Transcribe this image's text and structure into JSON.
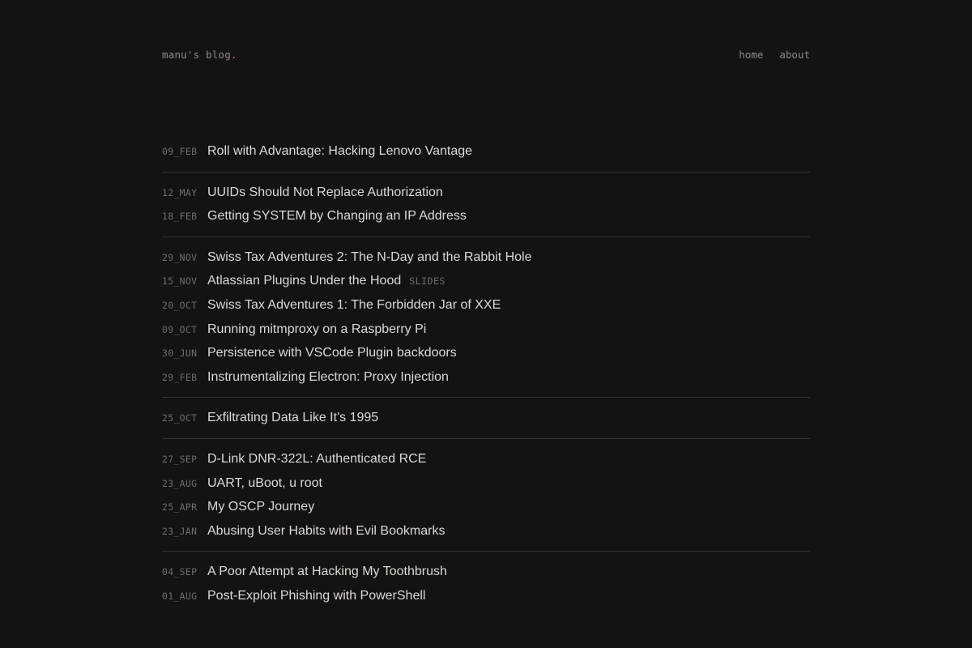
{
  "header": {
    "brand": "manu's blog",
    "brand_dot": ".",
    "nav": [
      {
        "label": "home"
      },
      {
        "label": "about"
      }
    ]
  },
  "groups": [
    {
      "posts": [
        {
          "date": "09_FEB",
          "title": "Roll with Advantage: Hacking Lenovo Vantage",
          "tag": ""
        }
      ]
    },
    {
      "posts": [
        {
          "date": "12_MAY",
          "title": "UUIDs Should Not Replace Authorization",
          "tag": ""
        },
        {
          "date": "18_FEB",
          "title": "Getting SYSTEM by Changing an IP Address",
          "tag": ""
        }
      ]
    },
    {
      "posts": [
        {
          "date": "29_NOV",
          "title": "Swiss Tax Adventures 2: The N-Day and the Rabbit Hole",
          "tag": ""
        },
        {
          "date": "15_NOV",
          "title": "Atlassian Plugins Under the Hood",
          "tag": "SLIDES"
        },
        {
          "date": "20_OCT",
          "title": "Swiss Tax Adventures 1: The Forbidden Jar of XXE",
          "tag": ""
        },
        {
          "date": "09_OCT",
          "title": "Running mitmproxy on a Raspberry Pi",
          "tag": ""
        },
        {
          "date": "30_JUN",
          "title": "Persistence with VSCode Plugin backdoors",
          "tag": ""
        },
        {
          "date": "29_FEB",
          "title": "Instrumentalizing Electron: Proxy Injection",
          "tag": ""
        }
      ]
    },
    {
      "posts": [
        {
          "date": "25_OCT",
          "title": "Exfiltrating Data Like It's 1995",
          "tag": ""
        }
      ]
    },
    {
      "posts": [
        {
          "date": "27_SEP",
          "title": "D-Link DNR-322L: Authenticated RCE",
          "tag": ""
        },
        {
          "date": "23_AUG",
          "title": "UART, uBoot, u root",
          "tag": ""
        },
        {
          "date": "25_APR",
          "title": "My OSCP Journey",
          "tag": ""
        },
        {
          "date": "23_JAN",
          "title": "Abusing User Habits with Evil Bookmarks",
          "tag": ""
        }
      ]
    },
    {
      "posts": [
        {
          "date": "04_SEP",
          "title": "A Poor Attempt at Hacking My Toothbrush",
          "tag": ""
        },
        {
          "date": "01_AUG",
          "title": "Post-Exploit Phishing with PowerShell",
          "tag": ""
        }
      ]
    }
  ],
  "colors": {
    "background": "#141314",
    "accent": "#d8742f"
  }
}
